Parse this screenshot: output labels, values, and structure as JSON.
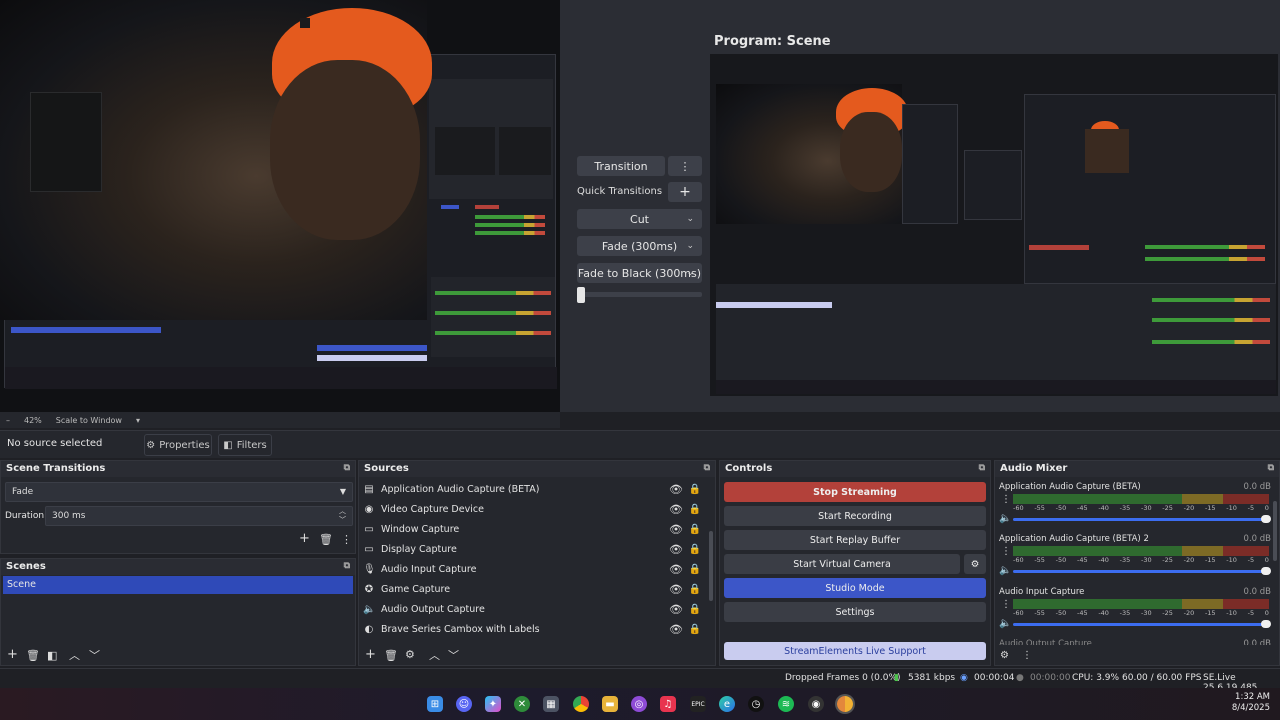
{
  "window": {
    "minimize": "—",
    "restore": "❐",
    "close": "✕"
  },
  "preview": {
    "zoom_minus": "–",
    "zoom_level": "42%",
    "scale_label": "Scale to Window",
    "program_title": "Program: Scene"
  },
  "transitions_panel": {
    "transition_label": "Transition",
    "quick_transitions_label": "Quick Transitions",
    "items": [
      "Cut",
      "Fade (300ms)",
      "Fade to Black (300ms)"
    ]
  },
  "source_bar": {
    "no_source": "No source selected",
    "properties": "Properties",
    "filters": "Filters"
  },
  "scene_transitions": {
    "title": "Scene Transitions",
    "selected": "Fade",
    "duration_label": "Duration",
    "duration_value": "300 ms"
  },
  "scenes": {
    "title": "Scenes",
    "items": [
      "Scene"
    ]
  },
  "sources": {
    "title": "Sources",
    "items": [
      {
        "icon": "▤",
        "label": "Application Audio Capture (BETA)"
      },
      {
        "icon": "◉",
        "label": "Video Capture Device"
      },
      {
        "icon": "▭",
        "label": "Window Capture"
      },
      {
        "icon": "▭",
        "label": "Display Capture"
      },
      {
        "icon": "🎙",
        "label": "Audio Input Capture"
      },
      {
        "icon": "✪",
        "label": "Game Capture"
      },
      {
        "icon": "🔈",
        "label": "Audio Output Capture"
      },
      {
        "icon": "◐",
        "label": "Brave Series Cambox with Labels"
      }
    ]
  },
  "controls": {
    "title": "Controls",
    "stop_streaming": "Stop Streaming",
    "start_recording": "Start Recording",
    "start_replay": "Start Replay Buffer",
    "start_virtual": "Start Virtual Camera",
    "studio_mode": "Studio Mode",
    "settings": "Settings",
    "support": "StreamElements Live Support"
  },
  "audio_mixer": {
    "title": "Audio Mixer",
    "scale": [
      "-60",
      "-55",
      "-50",
      "-45",
      "-40",
      "-35",
      "-30",
      "-25",
      "-20",
      "-15",
      "-10",
      "-5",
      "0"
    ],
    "channels": [
      {
        "name": "Application Audio Capture (BETA)",
        "db": "0.0 dB"
      },
      {
        "name": "Application Audio Capture (BETA) 2",
        "db": "0.0 dB"
      },
      {
        "name": "Audio Input Capture",
        "db": "0.0 dB"
      },
      {
        "name": "Audio Output Capture",
        "db": "0.0 dB"
      }
    ]
  },
  "status": {
    "dropped": "Dropped Frames 0 (0.0%)",
    "kbps": "5381 kbps",
    "stream_time": "00:00:04",
    "rec_time": "00:00:00",
    "cpu": "CPU: 3.9%",
    "fps": "60.00 / 60.00 FPS",
    "version": "SE.Live 25.6.19.485"
  },
  "taskbar": {
    "time": "1:32 AM",
    "date": "8/4/2025",
    "apps": [
      "windows-start",
      "discord",
      "copilot",
      "xbox",
      "store",
      "chrome",
      "file-explorer",
      "podcasts",
      "apple-music",
      "epic-games",
      "edge",
      "clock",
      "spotify",
      "obs",
      "chrome-canary"
    ]
  },
  "colors": {
    "stop_red": "#b3413a",
    "studio_blue": "#3c56c8",
    "support_lavender": "#c9ccef",
    "scene_selected": "#2f4ab8"
  }
}
